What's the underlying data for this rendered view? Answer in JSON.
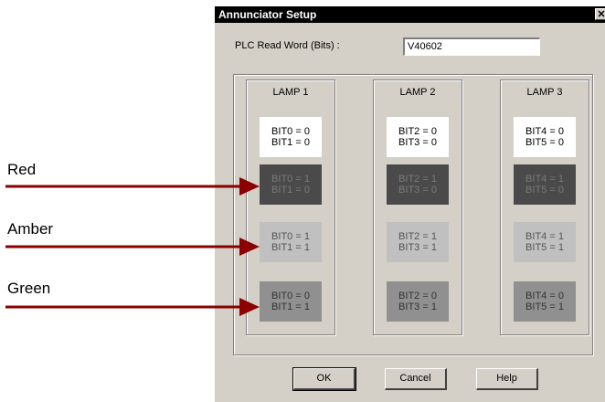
{
  "annotations": {
    "red": "Red",
    "amber": "Amber",
    "green": "Green",
    "arrow_color": "#8b0000"
  },
  "window": {
    "title": "Annunciator Setup",
    "close_glyph": "✕"
  },
  "plc": {
    "label": "PLC Read Word (Bits) :",
    "value": "V40602"
  },
  "lamps": [
    {
      "title": "LAMP 1",
      "off": [
        "BIT0 = 0",
        "BIT1 = 0"
      ],
      "red": [
        "BIT0 = 1",
        "BIT1 = 0"
      ],
      "amber": [
        "BIT0 = 1",
        "BIT1 = 1"
      ],
      "green": [
        "BIT0 = 0",
        "BIT1 = 1"
      ]
    },
    {
      "title": "LAMP 2",
      "off": [
        "BIT2 = 0",
        "BIT3 = 0"
      ],
      "red": [
        "BIT2 = 1",
        "BIT3 = 0"
      ],
      "amber": [
        "BIT2 = 1",
        "BIT3 = 1"
      ],
      "green": [
        "BIT2 = 0",
        "BIT3 = 1"
      ]
    },
    {
      "title": "LAMP 3",
      "off": [
        "BIT4 = 0",
        "BIT5 = 0"
      ],
      "red": [
        "BIT4 = 1",
        "BIT5 = 0"
      ],
      "amber": [
        "BIT4 = 1",
        "BIT5 = 1"
      ],
      "green": [
        "BIT4 = 0",
        "BIT5 = 1"
      ]
    }
  ],
  "buttons": {
    "ok": "OK",
    "cancel": "Cancel",
    "help": "Help"
  }
}
